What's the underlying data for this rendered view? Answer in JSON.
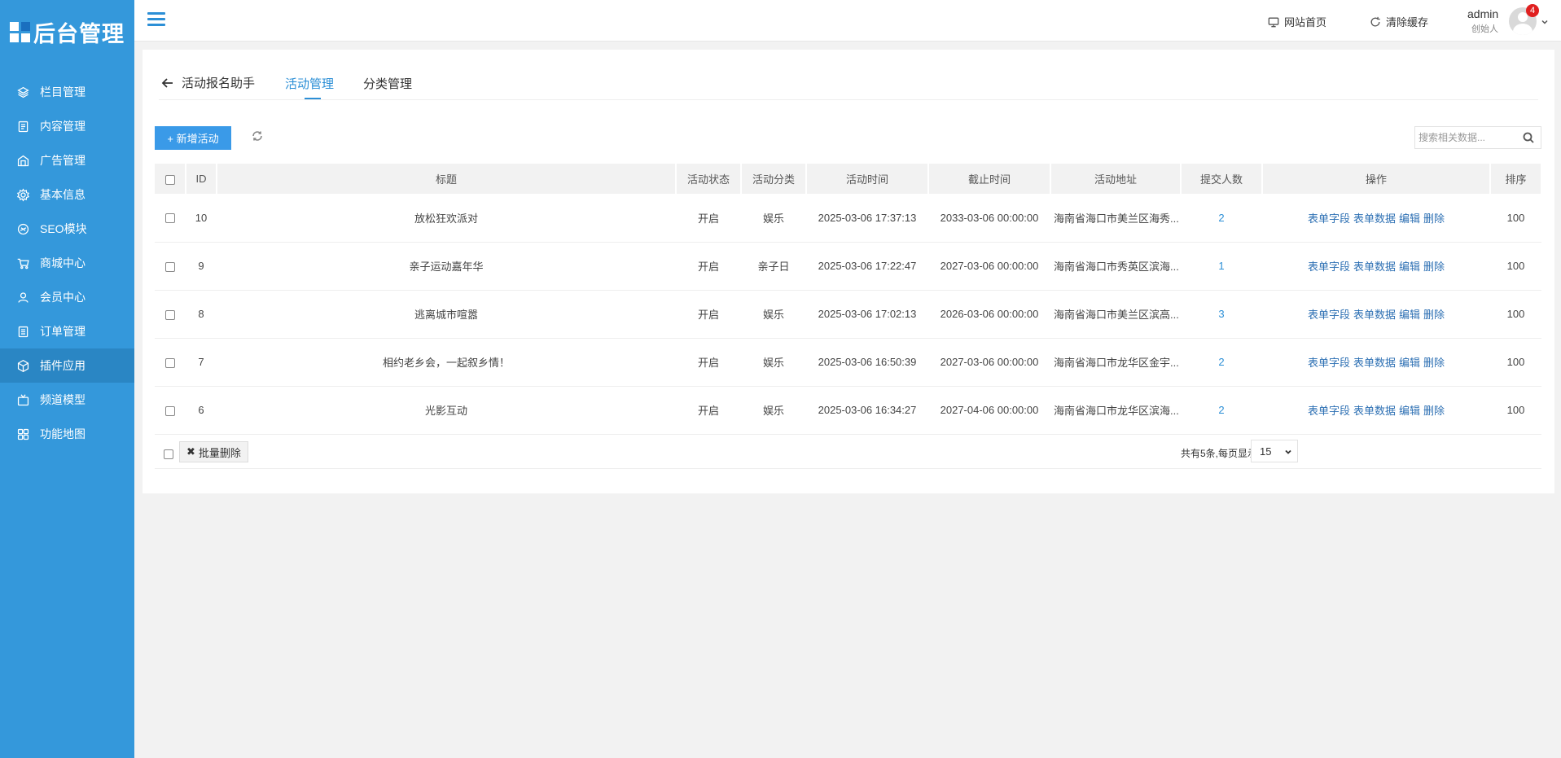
{
  "brand": {
    "logo_text": "后台管理"
  },
  "sidebar": {
    "items": [
      {
        "label": "栏目管理",
        "icon": "layers-icon"
      },
      {
        "label": "内容管理",
        "icon": "document-icon"
      },
      {
        "label": "广告管理",
        "icon": "megaphone-icon"
      },
      {
        "label": "基本信息",
        "icon": "gear-icon"
      },
      {
        "label": "SEO模块",
        "icon": "seo-icon"
      },
      {
        "label": "商城中心",
        "icon": "cart-icon"
      },
      {
        "label": "会员中心",
        "icon": "user-icon"
      },
      {
        "label": "订单管理",
        "icon": "list-icon"
      },
      {
        "label": "插件应用",
        "icon": "cube-icon",
        "active": true
      },
      {
        "label": "频道模型",
        "icon": "tv-icon"
      },
      {
        "label": "功能地图",
        "icon": "grid-icon"
      }
    ]
  },
  "header": {
    "site_home": "网站首页",
    "clear_cache": "清除缓存",
    "user_name": "admin",
    "user_role": "创始人",
    "badge_count": "4"
  },
  "tabs": {
    "back_label": "活动报名助手",
    "items": [
      "活动管理",
      "分类管理"
    ],
    "active": "活动管理"
  },
  "toolbar": {
    "add_label": "+ 新增活动",
    "search_placeholder": "搜索相关数据..."
  },
  "table": {
    "headers": [
      "ID",
      "标题",
      "活动状态",
      "活动分类",
      "活动时间",
      "截止时间",
      "活动地址",
      "提交人数",
      "操作",
      "排序"
    ],
    "ops": [
      "表单字段",
      "表单数据",
      "编辑",
      "删除"
    ],
    "rows": [
      {
        "id": "10",
        "title": "放松狂欢派对",
        "status": "开启",
        "category": "娱乐",
        "start": "2025-03-06 17:37:13",
        "end": "2033-03-06 00:00:00",
        "address": "海南省海口市美兰区海秀...",
        "count": "2",
        "sort": "100"
      },
      {
        "id": "9",
        "title": "亲子运动嘉年华",
        "status": "开启",
        "category": "亲子日",
        "start": "2025-03-06 17:22:47",
        "end": "2027-03-06 00:00:00",
        "address": "海南省海口市秀英区滨海...",
        "count": "1",
        "sort": "100"
      },
      {
        "id": "8",
        "title": "逃离城市喧嚣",
        "status": "开启",
        "category": "娱乐",
        "start": "2025-03-06 17:02:13",
        "end": "2026-03-06 00:00:00",
        "address": "海南省海口市美兰区滨高...",
        "count": "3",
        "sort": "100"
      },
      {
        "id": "7",
        "title": "相约老乡会，一起叙乡情！",
        "status": "开启",
        "category": "娱乐",
        "start": "2025-03-06 16:50:39",
        "end": "2027-03-06 00:00:00",
        "address": "海南省海口市龙华区金宇...",
        "count": "2",
        "sort": "100"
      },
      {
        "id": "6",
        "title": "光影互动",
        "status": "开启",
        "category": "娱乐",
        "start": "2025-03-06 16:34:27",
        "end": "2027-04-06 00:00:00",
        "address": "海南省海口市龙华区滨海...",
        "count": "2",
        "sort": "100"
      }
    ]
  },
  "footer": {
    "batch_delete": "批量删除",
    "batch_icon": "✖",
    "pager_info": "共有5条,每页显示",
    "page_size": "15"
  }
}
